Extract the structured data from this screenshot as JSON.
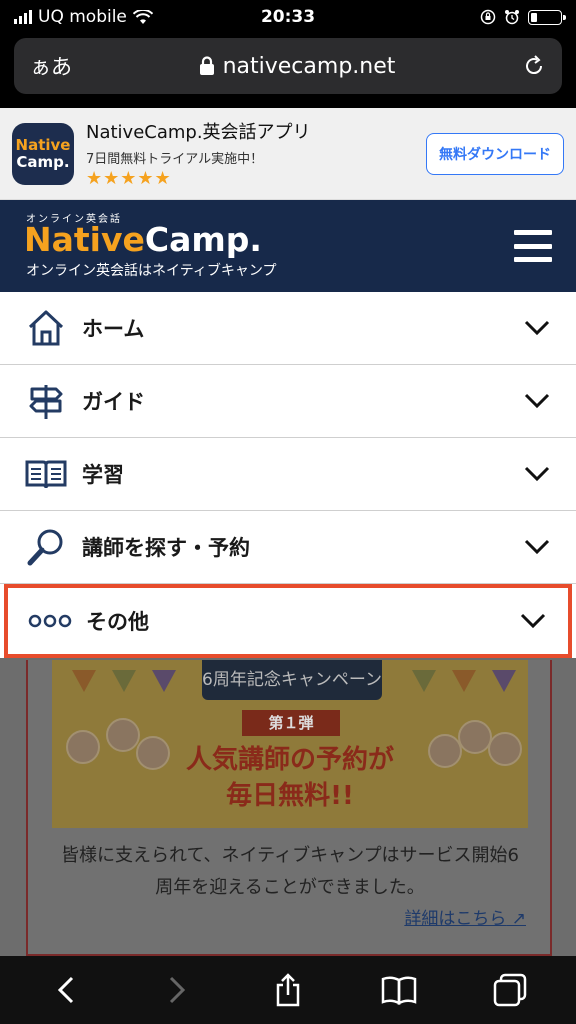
{
  "status_bar": {
    "carrier": "UQ mobile",
    "time": "20:33",
    "battery_level": 0.2
  },
  "url_bar": {
    "aa_label": "ぁあ",
    "domain": "nativecamp.net"
  },
  "app_banner": {
    "logo_line1": "Native",
    "logo_line2": "Camp.",
    "app_name": "NativeCamp.英会話アプリ",
    "subtitle": "7日間無料トライアル実施中！",
    "stars": "★★★★★",
    "download_label": "無料ダウンロード"
  },
  "site_header": {
    "tag": "オンライン英会話",
    "logo_native": "Native",
    "logo_camp": "Camp.",
    "tagline": "オンライン英会話はネイティブキャンプ"
  },
  "menu": {
    "items": [
      {
        "label": "ホーム",
        "icon": "home-icon"
      },
      {
        "label": "ガイド",
        "icon": "signpost-icon"
      },
      {
        "label": "学習",
        "icon": "book-icon"
      },
      {
        "label": "講師を探す・予約",
        "icon": "search-icon"
      },
      {
        "label": "その他",
        "icon": "more-dots-icon"
      }
    ]
  },
  "campaign": {
    "ribbon": "6周年記念キャンペーン",
    "stage": "第１弾",
    "headline_line1": "人気講師の予約が",
    "headline_line2": "毎日無料!!",
    "description": "皆様に支えられて、ネイティブキャンプはサービス開始6周年を迎えることができました。",
    "more_link": "詳細はこちら"
  },
  "colors": {
    "brand_navy": "#17294a",
    "brand_orange": "#f5a21f",
    "highlight_red": "#e74c2c",
    "ios_blue": "#3478f6"
  }
}
